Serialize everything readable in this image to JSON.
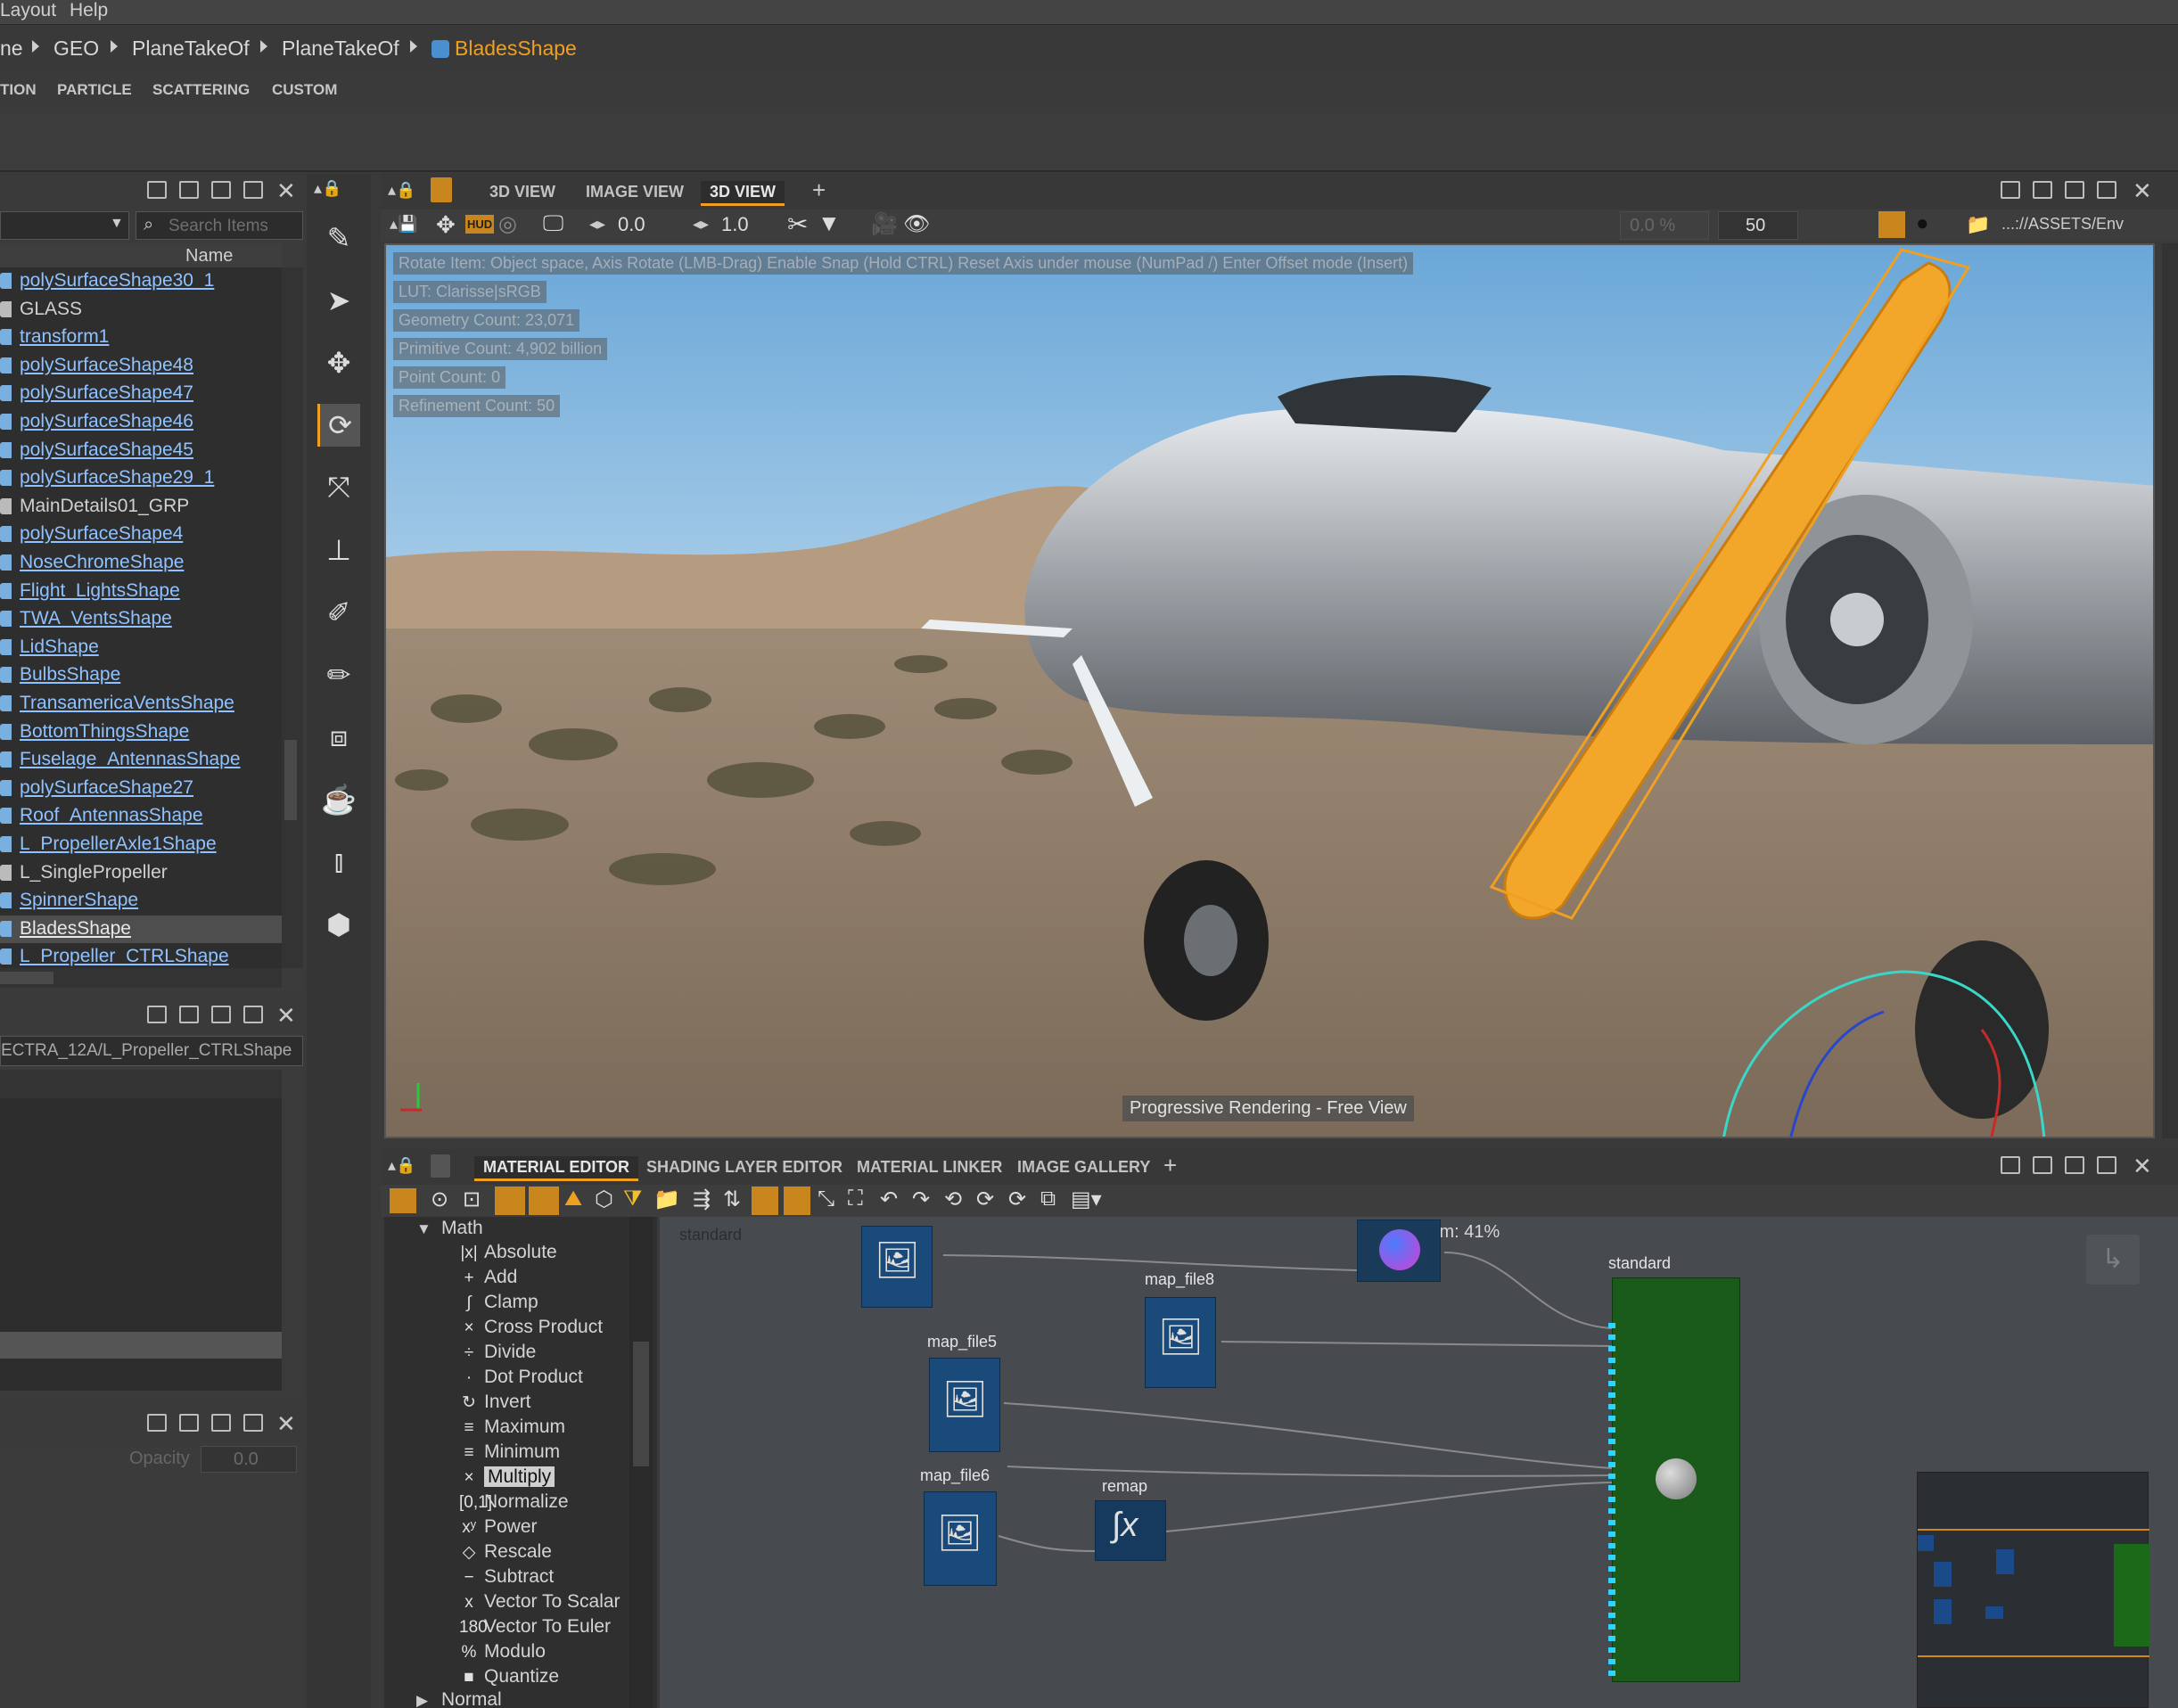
{
  "menu": {
    "items": [
      "Layout",
      "Help"
    ]
  },
  "breadcrumb": {
    "items": [
      "ne",
      "GEO",
      "PlaneTakeOf",
      "PlaneTakeOf",
      "BladesShape"
    ]
  },
  "shelf_tabs": [
    "TION",
    "PARTICLE",
    "SCATTERING",
    "CUSTOM"
  ],
  "outliner": {
    "search_placeholder": "Search Items",
    "column_name": "Name",
    "items": [
      {
        "label": "polySurfaceShape30_1",
        "link": true
      },
      {
        "label": "GLASS",
        "link": false
      },
      {
        "label": "transform1",
        "link": true
      },
      {
        "label": "polySurfaceShape48",
        "link": true
      },
      {
        "label": "polySurfaceShape47",
        "link": true
      },
      {
        "label": "polySurfaceShape46",
        "link": true
      },
      {
        "label": "polySurfaceShape45",
        "link": true
      },
      {
        "label": "polySurfaceShape29_1",
        "link": true
      },
      {
        "label": "MainDetails01_GRP",
        "link": false
      },
      {
        "label": "polySurfaceShape4",
        "link": true
      },
      {
        "label": "NoseChromeShape",
        "link": true
      },
      {
        "label": "Flight_LightsShape",
        "link": true
      },
      {
        "label": "TWA_VentsShape",
        "link": true
      },
      {
        "label": "LidShape",
        "link": true
      },
      {
        "label": "BulbsShape",
        "link": true
      },
      {
        "label": "TransamericaVentsShape",
        "link": true
      },
      {
        "label": "BottomThingsShape",
        "link": true
      },
      {
        "label": "Fuselage_AntennasShape",
        "link": true
      },
      {
        "label": "polySurfaceShape27",
        "link": true
      },
      {
        "label": "Roof_AntennasShape",
        "link": true
      },
      {
        "label": "L_PropellerAxle1Shape",
        "link": true
      },
      {
        "label": "L_SinglePropeller",
        "link": false
      },
      {
        "label": "SpinnerShape",
        "link": true
      },
      {
        "label": "BladesShape",
        "link": true,
        "selected": true
      },
      {
        "label": "L_Propeller_CTRLShape",
        "link": true
      }
    ]
  },
  "attr_panel": {
    "path": "ECTRA_12A/L_Propeller_CTRLShape"
  },
  "layer_panel": {
    "opacity_label": "Opacity",
    "opacity_value": "0.0"
  },
  "viewport": {
    "tabs": [
      "3D VIEW",
      "IMAGE VIEW",
      "3D VIEW"
    ],
    "active_tab": 2,
    "toolbar": {
      "hud": "HUD",
      "val1": "0.0",
      "val2": "1.0",
      "percent": "0.0 %",
      "samples": "50",
      "path": "...://ASSETS/Env"
    },
    "hud_lines": [
      "Rotate Item: Object space, Axis Rotate (LMB-Drag)  Enable Snap (Hold CTRL)  Reset Axis under mouse (NumPad /)  Enter Offset mode (Insert)",
      "LUT: Clarisse|sRGB",
      "Geometry Count: 23,071",
      "Primitive Count: 4,902 billion",
      "Point Count: 0",
      "Refinement Count: 50"
    ],
    "status": "Progressive Rendering - Free View"
  },
  "material_editor": {
    "tabs": [
      "MATERIAL EDITOR",
      "SHADING LAYER EDITOR",
      "MATERIAL LINKER",
      "IMAGE GALLERY"
    ],
    "active_tab": 0,
    "category": "Math",
    "category_next": "Normal",
    "nodes_list": [
      {
        "icon": "|x|",
        "label": "Absolute"
      },
      {
        "icon": "+",
        "label": "Add"
      },
      {
        "icon": "∫",
        "label": "Clamp"
      },
      {
        "icon": "×",
        "label": "Cross Product"
      },
      {
        "icon": "÷",
        "label": "Divide"
      },
      {
        "icon": "·",
        "label": "Dot Product"
      },
      {
        "icon": "↻",
        "label": "Invert"
      },
      {
        "icon": "≡",
        "label": "Maximum"
      },
      {
        "icon": "≡",
        "label": "Minimum"
      },
      {
        "icon": "×",
        "label": "Multiply",
        "selected": true
      },
      {
        "icon": "[0,1]",
        "label": "Normalize"
      },
      {
        "icon": "xʸ",
        "label": "Power"
      },
      {
        "icon": "◇",
        "label": "Rescale"
      },
      {
        "icon": "−",
        "label": "Subtract"
      },
      {
        "icon": "x",
        "label": "Vector To Scalar"
      },
      {
        "icon": "180",
        "label": "Vector To Euler"
      },
      {
        "icon": "%",
        "label": "Modulo"
      },
      {
        "icon": "■",
        "label": "Quantize"
      }
    ],
    "graph": {
      "context": "standard",
      "zoom": "Zoom: 41%",
      "node_labels": [
        "map_file8",
        "map_file5",
        "map_file6",
        "remap",
        "standard"
      ]
    }
  },
  "colors": {
    "accent": "#f0a020",
    "link": "#8fc2ff",
    "node_blue": "#1a4a7a",
    "node_green": "#1a5a1a"
  }
}
